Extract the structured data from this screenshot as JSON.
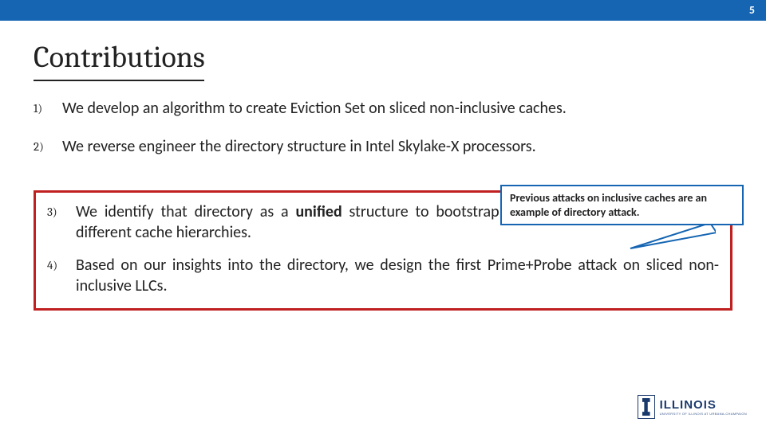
{
  "page_number": "5",
  "title": "Contributions",
  "items": [
    {
      "num": "1)",
      "text": "We develop an algorithm to create Eviction Set on sliced non-inclusive caches."
    },
    {
      "num": "2)",
      "text": "We reverse engineer the directory structure in Intel Skylake-X processors."
    },
    {
      "num": "3)",
      "pre": "We identify that directory as a ",
      "bold": "unified",
      "post": " structure to bootstrap conflict-based cache attacks for different cache hierarchies."
    },
    {
      "num": "4)",
      "text": "Based on our insights into the directory, we design the first Prime+Probe attack on sliced non-inclusive LLCs."
    }
  ],
  "callout": "Previous attacks on inclusive caches are an example of directory attack.",
  "logo": {
    "main": "ILLINOIS",
    "sub": "UNIVERSITY OF ILLINOIS AT URBANA-CHAMPAIGN"
  }
}
